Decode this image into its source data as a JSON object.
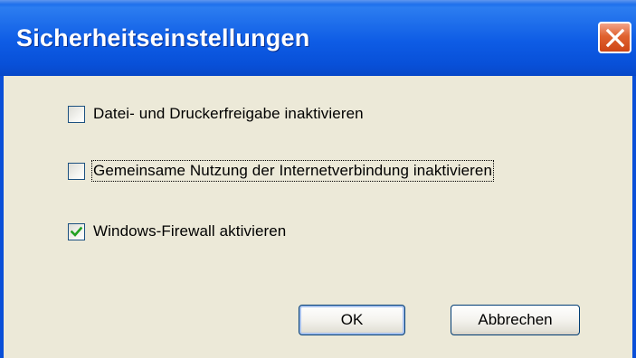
{
  "dialog": {
    "title": "Sicherheitseinstellungen",
    "close_icon": "close-icon",
    "accent_color": "#0A5EE6",
    "close_color": "#E0622F"
  },
  "options": [
    {
      "label": "Datei- und Druckerfreigabe inaktivieren",
      "checked": false
    },
    {
      "label": "Gemeinsame Nutzung der Internetverbindung inaktivieren",
      "checked": false,
      "focused": true
    },
    {
      "label": "Windows-Firewall aktivieren",
      "checked": true
    }
  ],
  "buttons": {
    "ok_label": "OK",
    "cancel_label": "Abbrechen"
  }
}
